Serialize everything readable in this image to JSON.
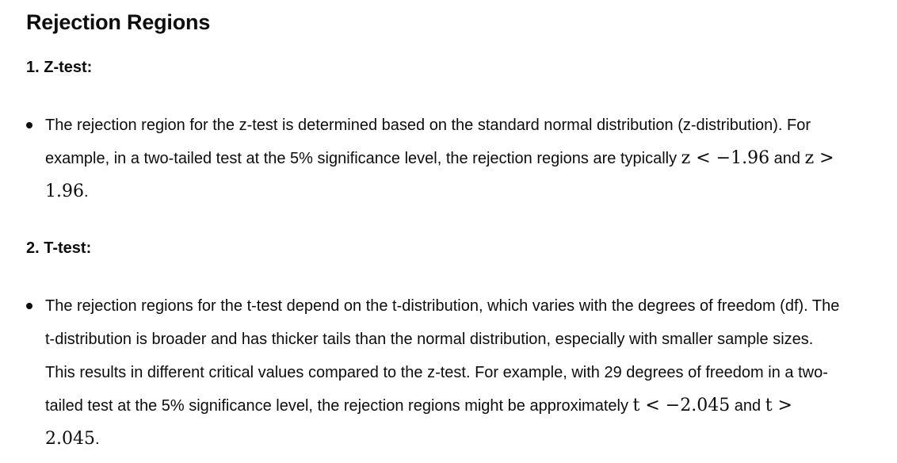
{
  "title": "Rejection Regions",
  "sections": [
    {
      "heading": "1. Z-test:",
      "bullet": {
        "text_before": "The rejection region for the z-test is determined based on the standard normal distribution (z-distribution). For example, in a two-tailed test at the 5% significance level, the rejection regions are typically ",
        "math1": "z < −1.96",
        "connector": " and ",
        "math2": "z > 1.96",
        "end": "."
      }
    },
    {
      "heading": "2. T-test:",
      "bullet": {
        "text_before": "The rejection regions for the t-test depend on the t-distribution, which varies with the degrees of freedom (df). The t-distribution is broader and has thicker tails than the normal distribution, especially with smaller sample sizes. This results in different critical values compared to the z-test. For example, with 29 degrees of freedom in a two-tailed test at the 5% significance level, the rejection regions might be approximately ",
        "math1": "t < −2.045",
        "connector": " and ",
        "math2": "t > 2.045",
        "end": "."
      }
    }
  ]
}
